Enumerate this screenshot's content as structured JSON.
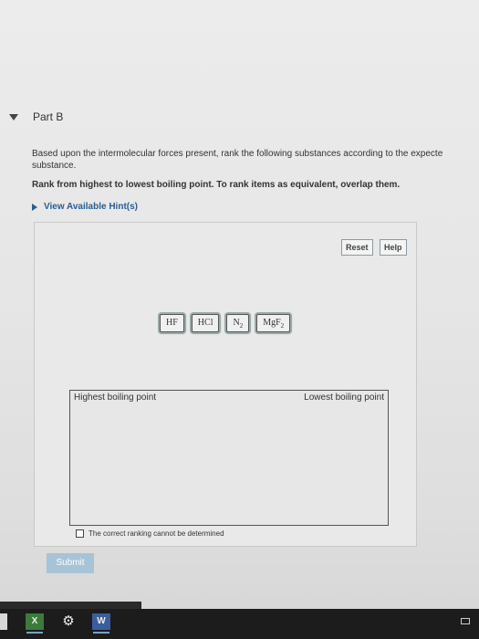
{
  "part": {
    "title": "Part B"
  },
  "question": {
    "line1": "Based upon the intermolecular forces present, rank the following substances according to the expecte",
    "line2": "substance.",
    "instruction": "Rank from highest to lowest boiling point. To rank items as equivalent, overlap them."
  },
  "hint": {
    "label": "View Available Hint(s)"
  },
  "toolbar": {
    "reset_label": "Reset",
    "help_label": "Help"
  },
  "items": [
    {
      "base": "HF",
      "sub": ""
    },
    {
      "base": "HCl",
      "sub": ""
    },
    {
      "base": "N",
      "sub": "2"
    },
    {
      "base": "MgF",
      "sub": "2"
    }
  ],
  "ranking": {
    "highest_label": "Highest boiling point",
    "lowest_label": "Lowest boiling point",
    "cannot_label": "The correct ranking cannot be determined"
  },
  "submit": {
    "label": "Submit"
  },
  "taskbar": {
    "excel_label": "X",
    "word_label": "W"
  }
}
